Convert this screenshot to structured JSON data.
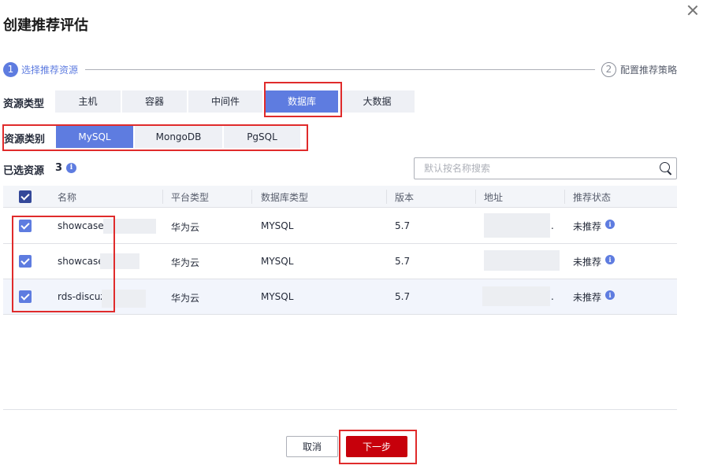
{
  "dialog": {
    "title": "创建推荐评估"
  },
  "steps": [
    {
      "number": "1",
      "label": "选择推荐资源",
      "active": true
    },
    {
      "number": "2",
      "label": "配置推荐策略",
      "active": false
    }
  ],
  "resource_type": {
    "label": "资源类型",
    "options": [
      "主机",
      "容器",
      "中间件",
      "数据库",
      "大数据"
    ],
    "selected": "数据库"
  },
  "resource_category": {
    "label": "资源类别",
    "options": [
      "MySQL",
      "MongoDB",
      "PgSQL"
    ],
    "selected": "MySQL"
  },
  "selection": {
    "label": "已选资源",
    "count": "3"
  },
  "search": {
    "placeholder": "默认按名称搜索"
  },
  "table": {
    "columns": [
      "名称",
      "平台类型",
      "数据库类型",
      "版本",
      "地址",
      "推荐状态"
    ],
    "rows": [
      {
        "name": "showcase-",
        "platform": "华为云",
        "db_type": "MYSQL",
        "version": "5.7",
        "address": ".",
        "status": "未推荐",
        "checked": true
      },
      {
        "name": "showcase",
        "platform": "华为云",
        "db_type": "MYSQL",
        "version": "5.7",
        "address": "",
        "status": "未推荐",
        "checked": true
      },
      {
        "name": "rds-discuz",
        "platform": "华为云",
        "db_type": "MYSQL",
        "version": "5.7",
        "address": ".",
        "status": "未推荐",
        "checked": true
      }
    ]
  },
  "footer": {
    "cancel_label": "取消",
    "next_label": "下一步"
  },
  "colors": {
    "accent": "#5e7ce0",
    "primary_button": "#c7000b",
    "highlight_box": "#e02b2b"
  }
}
